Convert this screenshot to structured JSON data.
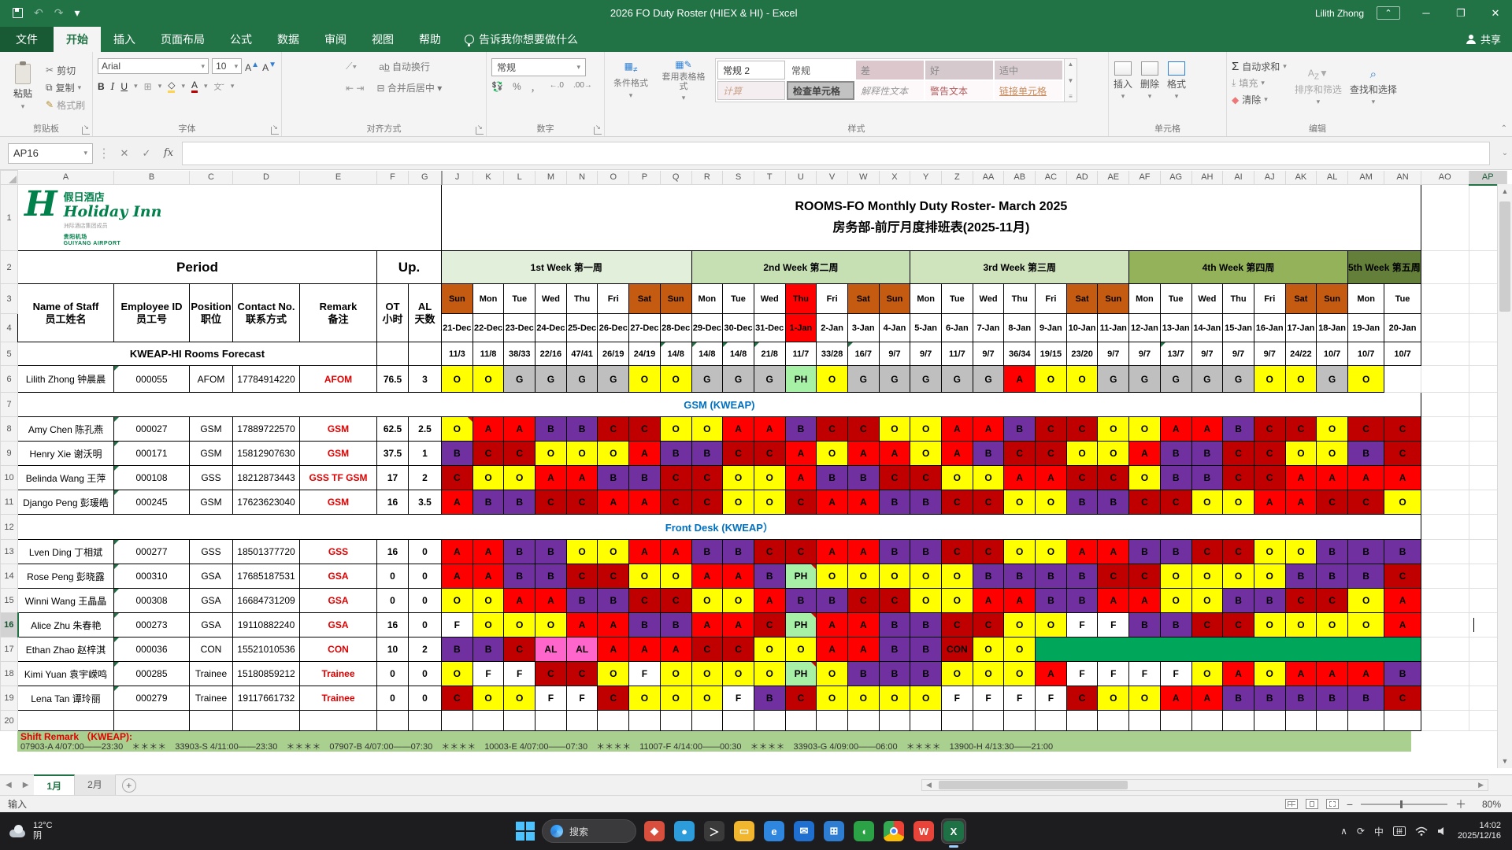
{
  "titlebar": {
    "title": "2026 FO Duty Roster (HIEX & HI)  -  Excel",
    "user": "Lilith Zhong",
    "minimize": "─",
    "restore": "❐",
    "close": "✕"
  },
  "menu": {
    "tabs": [
      {
        "label": "文件",
        "active": false,
        "file": true
      },
      {
        "label": "开始",
        "active": true
      },
      {
        "label": "插入"
      },
      {
        "label": "页面布局"
      },
      {
        "label": "公式"
      },
      {
        "label": "数据"
      },
      {
        "label": "审阅"
      },
      {
        "label": "视图"
      },
      {
        "label": "帮助"
      }
    ],
    "tellme": "告诉我你想要做什么",
    "share": "共享"
  },
  "ribbon": {
    "clipboard": {
      "paste": "粘贴",
      "cut": "剪切",
      "copy": "复制",
      "painter": "格式刷",
      "label": "剪贴板"
    },
    "font": {
      "family": "Arial",
      "size": "10",
      "label": "字体"
    },
    "align": {
      "wrap": "自动换行",
      "merge": "合并后居中",
      "label": "对齐方式"
    },
    "number": {
      "format": "常规",
      "label": "数字"
    },
    "styles": {
      "cond": "条件格式",
      "table": "套用表格格式",
      "label": "样式",
      "gallery": [
        "常规 2",
        "常规",
        "差",
        "好",
        "适中",
        "计算",
        "检查单元格",
        "解释性文本",
        "警告文本",
        "链接单元格"
      ]
    },
    "cells": {
      "insert": "插入",
      "delete": "删除",
      "format": "格式",
      "label": "单元格"
    },
    "editing": {
      "autosum": "自动求和",
      "fill": "填充",
      "clear": "清除",
      "sort": "排序和筛选",
      "find": "查找和选择",
      "label": "编辑"
    }
  },
  "formula": {
    "name_box": "AP16",
    "value": ""
  },
  "sheet": {
    "col_letters": [
      "A",
      "B",
      "C",
      "D",
      "E",
      "F",
      "G",
      "J",
      "K",
      "L",
      "M",
      "N",
      "O",
      "P",
      "Q",
      "R",
      "S",
      "T",
      "U",
      "V",
      "W",
      "X",
      "Y",
      "Z",
      "AA",
      "AB",
      "AC",
      "AD",
      "AE",
      "AF",
      "AG",
      "AH",
      "AI",
      "AJ",
      "AK",
      "AL",
      "AM",
      "AN",
      "AO",
      "AP"
    ],
    "selected_col": "AP",
    "selected_row": 16,
    "logo": {
      "cn": "假日酒店",
      "en": "Holiday Inn",
      "tiny": "洲际酒店集团成员",
      "air1": "贵阳机场",
      "air2": "GUIYANG AIRPORT"
    },
    "title1": "ROOMS-FO Monthly Duty Roster- March 2025",
    "title2": "房务部-前厅月度排班表(2025-11月)",
    "period": "Period",
    "up": "Up.",
    "weeks": [
      {
        "label": "1st Week 第一周",
        "span": 8,
        "color": "#E2EFDA"
      },
      {
        "label": "2nd Week 第二周",
        "span": 7,
        "color": "#C6E0B4"
      },
      {
        "label": "3rd Week 第三周",
        "span": 7,
        "color": "#CFE3BC"
      },
      {
        "label": "4th Week 第四周",
        "span": 7,
        "color": "#94B25A"
      },
      {
        "label": "5th Week 第五周",
        "span": 2,
        "color": "#637F39"
      }
    ],
    "left_headers": [
      {
        "en": "Name of Staff",
        "cn": "员工姓名"
      },
      {
        "en": "Employee ID",
        "cn": "员工号"
      },
      {
        "en": "Position",
        "cn": "职位"
      },
      {
        "en": "Contact No.",
        "cn": "联系方式"
      },
      {
        "en": "Remark",
        "cn": "备注"
      },
      {
        "en": "OT",
        "cn": "小时"
      },
      {
        "en": "AL",
        "cn": "天数"
      }
    ],
    "day_names": [
      "Sun",
      "Mon",
      "Tue",
      "Wed",
      "Thu",
      "Fri",
      "Sat",
      "Sun",
      "Mon",
      "Tue",
      "Wed",
      "Thu",
      "Fri",
      "Sat",
      "Sun",
      "Mon",
      "Tue",
      "Wed",
      "Thu",
      "Fri",
      "Sat",
      "Sun",
      "Mon",
      "Tue",
      "Wed",
      "Thu",
      "Fri",
      "Sat",
      "Sun",
      "Mon",
      "Tue"
    ],
    "dates": [
      "21-Dec",
      "22-Dec",
      "23-Dec",
      "24-Dec",
      "25-Dec",
      "26-Dec",
      "27-Dec",
      "28-Dec",
      "29-Dec",
      "30-Dec",
      "31-Dec",
      "1-Jan",
      "2-Jan",
      "3-Jan",
      "4-Jan",
      "5-Jan",
      "6-Jan",
      "7-Jan",
      "8-Jan",
      "9-Jan",
      "10-Jan",
      "11-Jan",
      "12-Jan",
      "13-Jan",
      "14-Jan",
      "15-Jan",
      "16-Jan",
      "17-Jan",
      "18-Jan",
      "19-Jan",
      "20-Jan"
    ],
    "holiday_index": 11,
    "weekend_color": "#C55A11",
    "holiday_color": "#FF0000",
    "forecast_label": "KWEAP-HI Rooms Forecast",
    "forecast": [
      "11/3",
      "11/8",
      "38/33",
      "22/16",
      "47/41",
      "26/19",
      "24/19",
      "14/8",
      "14/8",
      "14/8",
      "21/8",
      "11/7",
      "33/28",
      "16/7",
      "9/7",
      "9/7",
      "11/7",
      "9/7",
      "36/34",
      "19/15",
      "23/20",
      "9/7",
      "9/7",
      "13/7",
      "9/7",
      "9/7",
      "9/7",
      "24/22",
      "10/7",
      "10/7",
      "10/7"
    ],
    "forecast_green_flags": [
      7,
      8,
      9,
      10,
      13,
      23
    ],
    "shift_colors": {
      "O": "#FFFF00",
      "A": "#FF0000",
      "B": "#7030A0",
      "C": "#C00000",
      "G": "#BFBFBF",
      "PH": "#A6F1A6",
      "F": "#FFFFFF",
      "AL": "#FF66CC",
      "CON": "#C00000"
    },
    "sections": [
      {
        "row": 7,
        "label": "GSM (KWEAP)"
      },
      {
        "row": 12,
        "label": "Front Desk (KWEAP）"
      }
    ],
    "staff": [
      {
        "row": 6,
        "name": "Lilith Zhong 钟晨晨",
        "id": "000055",
        "position": "AFOM",
        "contact": "17784914220",
        "remark": "AFOM",
        "ot": "76.5",
        "al": "3",
        "shifts": [
          "O",
          "O",
          "G",
          "G",
          "G",
          "G",
          "O",
          "O",
          "G",
          "G",
          "G",
          "PH",
          "O",
          "G",
          "G",
          "G",
          "G",
          "G",
          "A",
          "O",
          "O",
          "G",
          "G",
          "G",
          "G",
          "G",
          "O",
          "O",
          "G",
          "O"
        ],
        "red": []
      },
      {
        "row": 8,
        "name": "Amy Chen 陈孔燕",
        "id": "000027",
        "position": "GSM",
        "contact": "17889722570",
        "remark": "GSM",
        "ot": "62.5",
        "al": "2.5",
        "shifts": [
          "O",
          "A",
          "A",
          "B",
          "B",
          "C",
          "C",
          "O",
          "O",
          "A",
          "A",
          "B",
          "C",
          "C",
          "O",
          "O",
          "A",
          "A",
          "B",
          "C",
          "C",
          "O",
          "O",
          "A",
          "A",
          "B",
          "C",
          "C",
          "O",
          "C",
          "C"
        ],
        "red": [
          0
        ]
      },
      {
        "row": 9,
        "name": "Henry Xie 谢沃明",
        "id": "000171",
        "position": "GSM",
        "contact": "15812907630",
        "remark": "GSM",
        "ot": "37.5",
        "al": "1",
        "shifts": [
          "B",
          "C",
          "C",
          "O",
          "O",
          "O",
          "A",
          "B",
          "B",
          "C",
          "C",
          "A",
          "O",
          "A",
          "A",
          "O",
          "A",
          "B",
          "C",
          "C",
          "O",
          "O",
          "A",
          "B",
          "B",
          "C",
          "C",
          "O",
          "O",
          "B",
          "C"
        ],
        "red": []
      },
      {
        "row": 10,
        "name": "Belinda Wang 王萍",
        "id": "000108",
        "position": "GSS",
        "contact": "18212873443",
        "remark": "GSS TF GSM",
        "ot": "17",
        "al": "2",
        "shifts": [
          "C",
          "O",
          "O",
          "A",
          "A",
          "B",
          "B",
          "C",
          "C",
          "O",
          "O",
          "A",
          "B",
          "B",
          "C",
          "C",
          "O",
          "O",
          "A",
          "A",
          "C",
          "C",
          "O",
          "B",
          "B",
          "C",
          "C",
          "A",
          "A",
          "A",
          "A"
        ],
        "red": []
      },
      {
        "row": 11,
        "name": "Django Peng 彭瑗皓",
        "id": "000245",
        "position": "GSM",
        "contact": "17623623040",
        "remark": "GSM",
        "ot": "16",
        "al": "3.5",
        "shifts": [
          "A",
          "B",
          "B",
          "C",
          "C",
          "A",
          "A",
          "C",
          "C",
          "O",
          "O",
          "C",
          "A",
          "A",
          "B",
          "B",
          "C",
          "C",
          "O",
          "O",
          "B",
          "B",
          "C",
          "C",
          "O",
          "O",
          "A",
          "A",
          "C",
          "C",
          "O"
        ],
        "red": []
      },
      {
        "row": 13,
        "name": "Lven Ding 丁相斌",
        "id": "000277",
        "position": "GSS",
        "contact": "18501377720",
        "remark": "GSS",
        "ot": "16",
        "al": "0",
        "shifts": [
          "A",
          "A",
          "B",
          "B",
          "O",
          "O",
          "A",
          "A",
          "B",
          "B",
          "C",
          "C",
          "A",
          "A",
          "B",
          "B",
          "C",
          "C",
          "O",
          "O",
          "A",
          "A",
          "B",
          "B",
          "C",
          "C",
          "O",
          "O",
          "B",
          "B",
          "B"
        ],
        "red": []
      },
      {
        "row": 14,
        "name": "Rose Peng 彭晓露",
        "id": "000310",
        "position": "GSA",
        "contact": "17685187531",
        "remark": "GSA",
        "ot": "0",
        "al": "0",
        "shifts": [
          "A",
          "A",
          "B",
          "B",
          "C",
          "C",
          "O",
          "O",
          "A",
          "A",
          "B",
          "PH",
          "O",
          "O",
          "O",
          "O",
          "O",
          "B",
          "B",
          "B",
          "B",
          "C",
          "C",
          "O",
          "O",
          "O",
          "O",
          "B",
          "B",
          "B",
          "C"
        ],
        "red": [
          11
        ]
      },
      {
        "row": 15,
        "name": "Winni Wang 王晶晶",
        "id": "000308",
        "position": "GSA",
        "contact": "16684731209",
        "remark": "GSA",
        "ot": "0",
        "al": "0",
        "shifts": [
          "O",
          "O",
          "A",
          "A",
          "B",
          "B",
          "C",
          "C",
          "O",
          "O",
          "A",
          "B",
          "B",
          "C",
          "C",
          "O",
          "O",
          "A",
          "A",
          "B",
          "B",
          "A",
          "A",
          "O",
          "O",
          "B",
          "B",
          "C",
          "C",
          "O",
          "A"
        ],
        "red": []
      },
      {
        "row": 16,
        "name": "Alice Zhu 朱春艳",
        "id": "000273",
        "position": "GSA",
        "contact": "19110882240",
        "remark": "GSA",
        "ot": "16",
        "al": "0",
        "shifts": [
          "F",
          "O",
          "O",
          "O",
          "A",
          "A",
          "B",
          "B",
          "A",
          "A",
          "C",
          "PH",
          "A",
          "A",
          "B",
          "B",
          "C",
          "C",
          "O",
          "O",
          "F",
          "F",
          "B",
          "B",
          "C",
          "C",
          "O",
          "O",
          "O",
          "O",
          "A"
        ],
        "red": [
          11
        ]
      },
      {
        "row": 17,
        "name": "Ethan Zhao 赵梓淇",
        "id": "000036",
        "position": "CON",
        "contact": "15521010536",
        "remark": "CON",
        "ot": "10",
        "al": "2",
        "shifts": [
          "B",
          "B",
          "C",
          "AL",
          "AL",
          "A",
          "A",
          "A",
          "C",
          "C",
          "O",
          "O",
          "A",
          "A",
          "B",
          "B",
          "CON",
          "O",
          "O",
          {
            "merge": 12,
            "color": "#00A65A",
            "label": ""
          }
        ],
        "red": []
      },
      {
        "row": 18,
        "name": "Kimi Yuan 袁宇嵘鸣",
        "id": "000285",
        "position": "Trainee",
        "contact": "15180859212",
        "remark": "Trainee",
        "ot": "0",
        "al": "0",
        "shifts": [
          "O",
          "F",
          "F",
          "C",
          "C",
          "O",
          "F",
          "O",
          "O",
          "O",
          "O",
          "PH",
          "O",
          "B",
          "B",
          "B",
          "O",
          "O",
          "O",
          "A",
          "F",
          "F",
          "F",
          "F",
          "O",
          "A",
          "O",
          "A",
          "A",
          "A",
          "B"
        ],
        "red": [
          11
        ]
      },
      {
        "row": 19,
        "name": "Lena Tan 谭玲丽",
        "id": "000279",
        "position": "Trainee",
        "contact": "19117661732",
        "remark": "Trainee",
        "ot": "0",
        "al": "0",
        "shifts": [
          "C",
          "O",
          "O",
          "F",
          "F",
          "C",
          "O",
          "O",
          "O",
          "F",
          "B",
          "C",
          "O",
          "O",
          "O",
          "O",
          "F",
          "F",
          "F",
          "F",
          "C",
          "O",
          "O",
          "A",
          "A",
          "B",
          "B",
          "B",
          "B",
          "B",
          "C"
        ],
        "red": []
      }
    ],
    "remark_title": "Shift Remark （KWEAP):",
    "remark_line": "07903-A 4/07:00——23:30　＊＊＊＊　33903-S 4/11:00——23:30　＊＊＊＊　07907-B 4/07:00——07:30　＊＊＊＊　10003-E 4/07:00——07:30　＊＊＊＊　11007-F 4/14:00——00:30　＊＊＊＊　33903-G 4/09:00——06:00　＊＊＊＊　13900-H 4/13:30——21:00"
  },
  "tabs_bar": {
    "sheets": [
      {
        "label": "1月",
        "active": true
      },
      {
        "label": "2月",
        "active": false
      }
    ],
    "add": "+"
  },
  "status_bar": {
    "mode": "输入",
    "zoom": "80%"
  },
  "taskbar": {
    "weather_temp": "12°C",
    "weather_cond": "阴",
    "search": "搜索",
    "apps": [
      {
        "name": "messenger-app-icon",
        "color": "#D94F3D",
        "glyph": "◆"
      },
      {
        "name": "contacts-app-icon",
        "color": "#2D9CDB",
        "glyph": "●"
      },
      {
        "name": "terminal-app-icon",
        "color": "#3A3A3A",
        "glyph": "＞"
      },
      {
        "name": "file-explorer-icon",
        "color": "#F2B52E",
        "glyph": "▭"
      },
      {
        "name": "edge-browser-icon",
        "color": "#2E86DE",
        "glyph": "e"
      },
      {
        "name": "mail-app-icon",
        "color": "#1E6FD0",
        "glyph": "✉"
      },
      {
        "name": "store-app-icon",
        "color": "#2D7DD2",
        "glyph": "⊞"
      },
      {
        "name": "wechat-app-icon",
        "color": "#2BA245",
        "glyph": "◖"
      },
      {
        "name": "chrome-browser-icon",
        "color": "chrome",
        "glyph": ""
      },
      {
        "name": "wps-app-icon",
        "color": "#E8443A",
        "glyph": "W"
      },
      {
        "name": "excel-app-icon",
        "color": "#1E7145",
        "glyph": "X",
        "active": true
      }
    ],
    "ime": "中",
    "time": "14:02",
    "date": "2025/12/16"
  }
}
